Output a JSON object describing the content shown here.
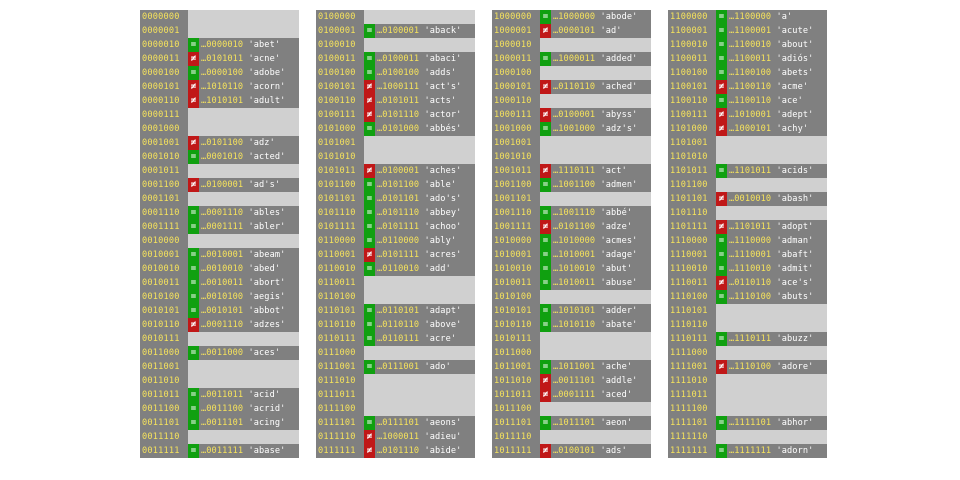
{
  "columns": [
    [
      {
        "addr": "0000000"
      },
      {
        "addr": "0000001"
      },
      {
        "addr": "0000010",
        "sym": "=",
        "key": "…0000010",
        "word": "'abet'"
      },
      {
        "addr": "0000011",
        "sym": "≠",
        "key": "…0101011",
        "word": "'acne'"
      },
      {
        "addr": "0000100",
        "sym": "=",
        "key": "…0000100",
        "word": "'adobe'"
      },
      {
        "addr": "0000101",
        "sym": "≠",
        "key": "…1010110",
        "word": "'acorn'"
      },
      {
        "addr": "0000110",
        "sym": "≠",
        "key": "…1010101",
        "word": "'adult'"
      },
      {
        "addr": "0000111"
      },
      {
        "addr": "0001000"
      },
      {
        "addr": "0001001",
        "sym": "≠",
        "key": "…0101100",
        "word": "'adz'"
      },
      {
        "addr": "0001010",
        "sym": "=",
        "key": "…0001010",
        "word": "'acted'"
      },
      {
        "addr": "0001011"
      },
      {
        "addr": "0001100",
        "sym": "≠",
        "key": "…0100001",
        "word": "'ad's'"
      },
      {
        "addr": "0001101"
      },
      {
        "addr": "0001110",
        "sym": "=",
        "key": "…0001110",
        "word": "'ables'"
      },
      {
        "addr": "0001111",
        "sym": "=",
        "key": "…0001111",
        "word": "'abler'"
      },
      {
        "addr": "0010000"
      },
      {
        "addr": "0010001",
        "sym": "=",
        "key": "…0010001",
        "word": "'abeam'"
      },
      {
        "addr": "0010010",
        "sym": "=",
        "key": "…0010010",
        "word": "'abed'"
      },
      {
        "addr": "0010011",
        "sym": "=",
        "key": "…0010011",
        "word": "'abort'"
      },
      {
        "addr": "0010100",
        "sym": "=",
        "key": "…0010100",
        "word": "'aegis'"
      },
      {
        "addr": "0010101",
        "sym": "=",
        "key": "…0010101",
        "word": "'abbot'"
      },
      {
        "addr": "0010110",
        "sym": "≠",
        "key": "…0001110",
        "word": "'adzes'"
      },
      {
        "addr": "0010111"
      },
      {
        "addr": "0011000",
        "sym": "=",
        "key": "…0011000",
        "word": "'aces'"
      },
      {
        "addr": "0011001"
      },
      {
        "addr": "0011010"
      },
      {
        "addr": "0011011",
        "sym": "=",
        "key": "…0011011",
        "word": "'acid'"
      },
      {
        "addr": "0011100",
        "sym": "=",
        "key": "…0011100",
        "word": "'acrid'"
      },
      {
        "addr": "0011101",
        "sym": "=",
        "key": "…0011101",
        "word": "'acing'"
      },
      {
        "addr": "0011110"
      },
      {
        "addr": "0011111",
        "sym": "=",
        "key": "…0011111",
        "word": "'abase'"
      }
    ],
    [
      {
        "addr": "0100000"
      },
      {
        "addr": "0100001",
        "sym": "=",
        "key": "…0100001",
        "word": "'aback'"
      },
      {
        "addr": "0100010"
      },
      {
        "addr": "0100011",
        "sym": "=",
        "key": "…0100011",
        "word": "'abaci'"
      },
      {
        "addr": "0100100",
        "sym": "=",
        "key": "…0100100",
        "word": "'adds'"
      },
      {
        "addr": "0100101",
        "sym": "≠",
        "key": "…1000111",
        "word": "'act's'"
      },
      {
        "addr": "0100110",
        "sym": "≠",
        "key": "…0101011",
        "word": "'acts'"
      },
      {
        "addr": "0100111",
        "sym": "≠",
        "key": "…0101110",
        "word": "'actor'"
      },
      {
        "addr": "0101000",
        "sym": "=",
        "key": "…0101000",
        "word": "'abbés'"
      },
      {
        "addr": "0101001"
      },
      {
        "addr": "0101010"
      },
      {
        "addr": "0101011",
        "sym": "≠",
        "key": "…0100001",
        "word": "'aches'"
      },
      {
        "addr": "0101100",
        "sym": "=",
        "key": "…0101100",
        "word": "'able'"
      },
      {
        "addr": "0101101",
        "sym": "=",
        "key": "…0101101",
        "word": "'ado's'"
      },
      {
        "addr": "0101110",
        "sym": "=",
        "key": "…0101110",
        "word": "'abbey'"
      },
      {
        "addr": "0101111",
        "sym": "=",
        "key": "…0101111",
        "word": "'achoo'"
      },
      {
        "addr": "0110000",
        "sym": "=",
        "key": "…0110000",
        "word": "'ably'"
      },
      {
        "addr": "0110001",
        "sym": "≠",
        "key": "…0101111",
        "word": "'acres'"
      },
      {
        "addr": "0110010",
        "sym": "=",
        "key": "…0110010",
        "word": "'add'"
      },
      {
        "addr": "0110011"
      },
      {
        "addr": "0110100"
      },
      {
        "addr": "0110101",
        "sym": "=",
        "key": "…0110101",
        "word": "'adapt'"
      },
      {
        "addr": "0110110",
        "sym": "=",
        "key": "…0110110",
        "word": "'above'"
      },
      {
        "addr": "0110111",
        "sym": "=",
        "key": "…0110111",
        "word": "'acre'"
      },
      {
        "addr": "0111000"
      },
      {
        "addr": "0111001",
        "sym": "=",
        "key": "…0111001",
        "word": "'ado'"
      },
      {
        "addr": "0111010"
      },
      {
        "addr": "0111011"
      },
      {
        "addr": "0111100"
      },
      {
        "addr": "0111101",
        "sym": "=",
        "key": "…0111101",
        "word": "'aeons'"
      },
      {
        "addr": "0111110",
        "sym": "≠",
        "key": "…1000011",
        "word": "'adieu'"
      },
      {
        "addr": "0111111",
        "sym": "≠",
        "key": "…0101110",
        "word": "'abide'"
      }
    ],
    [
      {
        "addr": "1000000",
        "sym": "=",
        "key": "…1000000",
        "word": "'abode'"
      },
      {
        "addr": "1000001",
        "sym": "≠",
        "key": "…0000101",
        "word": "'ad'"
      },
      {
        "addr": "1000010"
      },
      {
        "addr": "1000011",
        "sym": "=",
        "key": "…1000011",
        "word": "'added'"
      },
      {
        "addr": "1000100"
      },
      {
        "addr": "1000101",
        "sym": "≠",
        "key": "…0110110",
        "word": "'ached'"
      },
      {
        "addr": "1000110"
      },
      {
        "addr": "1000111",
        "sym": "≠",
        "key": "…0100001",
        "word": "'abyss'"
      },
      {
        "addr": "1001000",
        "sym": "=",
        "key": "…1001000",
        "word": "'adz's'"
      },
      {
        "addr": "1001001"
      },
      {
        "addr": "1001010"
      },
      {
        "addr": "1001011",
        "sym": "≠",
        "key": "…1110111",
        "word": "'act'"
      },
      {
        "addr": "1001100",
        "sym": "=",
        "key": "…1001100",
        "word": "'admen'"
      },
      {
        "addr": "1001101"
      },
      {
        "addr": "1001110",
        "sym": "=",
        "key": "…1001110",
        "word": "'abbé'"
      },
      {
        "addr": "1001111",
        "sym": "≠",
        "key": "…0101100",
        "word": "'adze'"
      },
      {
        "addr": "1010000",
        "sym": "=",
        "key": "…1010000",
        "word": "'acmes'"
      },
      {
        "addr": "1010001",
        "sym": "=",
        "key": "…1010001",
        "word": "'adage'"
      },
      {
        "addr": "1010010",
        "sym": "=",
        "key": "…1010010",
        "word": "'abut'"
      },
      {
        "addr": "1010011",
        "sym": "=",
        "key": "…1010011",
        "word": "'abuse'"
      },
      {
        "addr": "1010100"
      },
      {
        "addr": "1010101",
        "sym": "=",
        "key": "…1010101",
        "word": "'adder'"
      },
      {
        "addr": "1010110",
        "sym": "=",
        "key": "…1010110",
        "word": "'abate'"
      },
      {
        "addr": "1010111"
      },
      {
        "addr": "1011000"
      },
      {
        "addr": "1011001",
        "sym": "=",
        "key": "…1011001",
        "word": "'ache'"
      },
      {
        "addr": "1011010",
        "sym": "≠",
        "key": "…0011101",
        "word": "'addle'"
      },
      {
        "addr": "1011011",
        "sym": "≠",
        "key": "…0001111",
        "word": "'aced'"
      },
      {
        "addr": "1011100"
      },
      {
        "addr": "1011101",
        "sym": "=",
        "key": "…1011101",
        "word": "'aeon'"
      },
      {
        "addr": "1011110"
      },
      {
        "addr": "1011111",
        "sym": "≠",
        "key": "…0100101",
        "word": "'ads'"
      }
    ],
    [
      {
        "addr": "1100000",
        "sym": "=",
        "key": "…1100000",
        "word": "'a'"
      },
      {
        "addr": "1100001",
        "sym": "=",
        "key": "…1100001",
        "word": "'acute'"
      },
      {
        "addr": "1100010",
        "sym": "=",
        "key": "…1100010",
        "word": "'about'"
      },
      {
        "addr": "1100011",
        "sym": "=",
        "key": "…1100011",
        "word": "'adiós'"
      },
      {
        "addr": "1100100",
        "sym": "=",
        "key": "…1100100",
        "word": "'abets'"
      },
      {
        "addr": "1100101",
        "sym": "≠",
        "key": "…1100110",
        "word": "'acme'"
      },
      {
        "addr": "1100110",
        "sym": "=",
        "key": "…1100110",
        "word": "'ace'"
      },
      {
        "addr": "1100111",
        "sym": "≠",
        "key": "…1010001",
        "word": "'adept'"
      },
      {
        "addr": "1101000",
        "sym": "≠",
        "key": "…1000101",
        "word": "'achy'"
      },
      {
        "addr": "1101001"
      },
      {
        "addr": "1101010"
      },
      {
        "addr": "1101011",
        "sym": "=",
        "key": "…1101011",
        "word": "'acids'"
      },
      {
        "addr": "1101100"
      },
      {
        "addr": "1101101",
        "sym": "≠",
        "key": "…0010010",
        "word": "'abash'"
      },
      {
        "addr": "1101110"
      },
      {
        "addr": "1101111",
        "sym": "≠",
        "key": "…1101011",
        "word": "'adopt'"
      },
      {
        "addr": "1110000",
        "sym": "=",
        "key": "…1110000",
        "word": "'adman'"
      },
      {
        "addr": "1110001",
        "sym": "=",
        "key": "…1110001",
        "word": "'abaft'"
      },
      {
        "addr": "1110010",
        "sym": "=",
        "key": "…1110010",
        "word": "'admit'"
      },
      {
        "addr": "1110011",
        "sym": "≠",
        "key": "…0110110",
        "word": "'ace's'"
      },
      {
        "addr": "1110100",
        "sym": "=",
        "key": "…1110100",
        "word": "'abuts'"
      },
      {
        "addr": "1110101"
      },
      {
        "addr": "1110110"
      },
      {
        "addr": "1110111",
        "sym": "=",
        "key": "…1110111",
        "word": "'abuzz'"
      },
      {
        "addr": "1111000"
      },
      {
        "addr": "1111001",
        "sym": "≠",
        "key": "…1110100",
        "word": "'adore'"
      },
      {
        "addr": "1111010"
      },
      {
        "addr": "1111011"
      },
      {
        "addr": "1111100"
      },
      {
        "addr": "1111101",
        "sym": "=",
        "key": "…1111101",
        "word": "'abhor'"
      },
      {
        "addr": "1111110"
      },
      {
        "addr": "1111111",
        "sym": "=",
        "key": "…1111111",
        "word": "'adorn'"
      }
    ]
  ],
  "colors": {
    "address_bg": "#808080",
    "address_text": "#f5e25c",
    "empty_slot_bg": "#d0d0d0",
    "filled_slot_bg": "#808080",
    "equal_marker_bg": "#10a010",
    "not_equal_marker_bg": "#c01818",
    "word_text": "#ffffff"
  }
}
